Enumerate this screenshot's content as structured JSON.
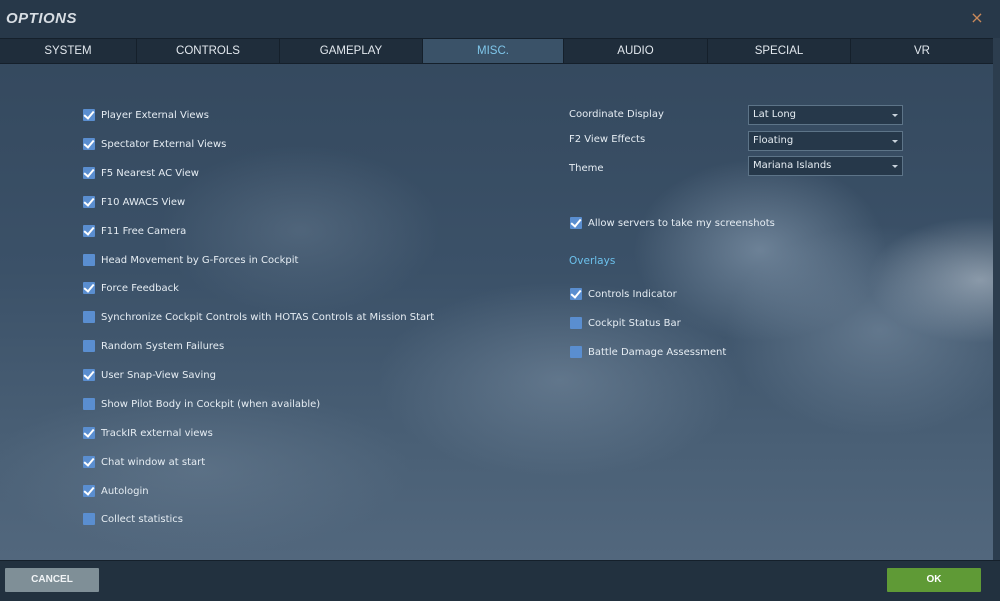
{
  "window": {
    "title": "OPTIONS",
    "close_glyph": "×",
    "close_icon": "close-icon"
  },
  "tabs": [
    {
      "label": "SYSTEM",
      "active": false
    },
    {
      "label": "CONTROLS",
      "active": false
    },
    {
      "label": "GAMEPLAY",
      "active": false
    },
    {
      "label": "MISC.",
      "active": true
    },
    {
      "label": "AUDIO",
      "active": false
    },
    {
      "label": "SPECIAL",
      "active": false
    },
    {
      "label": "VR",
      "active": false
    }
  ],
  "left_options": [
    {
      "label": "Player External Views",
      "checked": true
    },
    {
      "label": "Spectator External Views",
      "checked": true
    },
    {
      "label": "F5 Nearest AC View",
      "checked": true
    },
    {
      "label": "F10 AWACS View",
      "checked": true
    },
    {
      "label": "F11 Free Camera",
      "checked": true
    },
    {
      "label": "Head Movement by G-Forces in Cockpit",
      "checked": false
    },
    {
      "label": "Force Feedback",
      "checked": true
    },
    {
      "label": "Synchronize Cockpit Controls with HOTAS Controls at Mission Start",
      "checked": false
    },
    {
      "label": "Random System Failures",
      "checked": false
    },
    {
      "label": "User Snap-View Saving",
      "checked": true
    },
    {
      "label": "Show Pilot Body in Cockpit (when available)",
      "checked": false
    },
    {
      "label": "TrackIR external views",
      "checked": true
    },
    {
      "label": "Chat window at start",
      "checked": true
    },
    {
      "label": "Autologin",
      "checked": true
    },
    {
      "label": "Collect statistics",
      "checked": false
    }
  ],
  "right_fields": {
    "coordinate_display": {
      "label": "Coordinate Display",
      "value": "Lat Long"
    },
    "f2_view_effects": {
      "label": "F2 View Effects",
      "value": "Floating"
    },
    "theme": {
      "label": "Theme",
      "value": "Mariana Islands"
    }
  },
  "allow_screenshots": {
    "label": "Allow servers to take my screenshots",
    "checked": true
  },
  "overlays": {
    "heading": "Overlays",
    "items": [
      {
        "label": "Controls Indicator",
        "checked": true
      },
      {
        "label": "Cockpit Status Bar",
        "checked": false
      },
      {
        "label": "Battle Damage Assessment",
        "checked": false
      }
    ]
  },
  "footer": {
    "cancel_label": "CANCEL",
    "ok_label": "OK"
  },
  "colors": {
    "accent_blue": "#6cc1ec",
    "checkbox_blue": "#5a8ed0",
    "ok_green": "#5f9a36",
    "cancel_grey": "#7f8f97",
    "close_orange": "#c9895a"
  }
}
